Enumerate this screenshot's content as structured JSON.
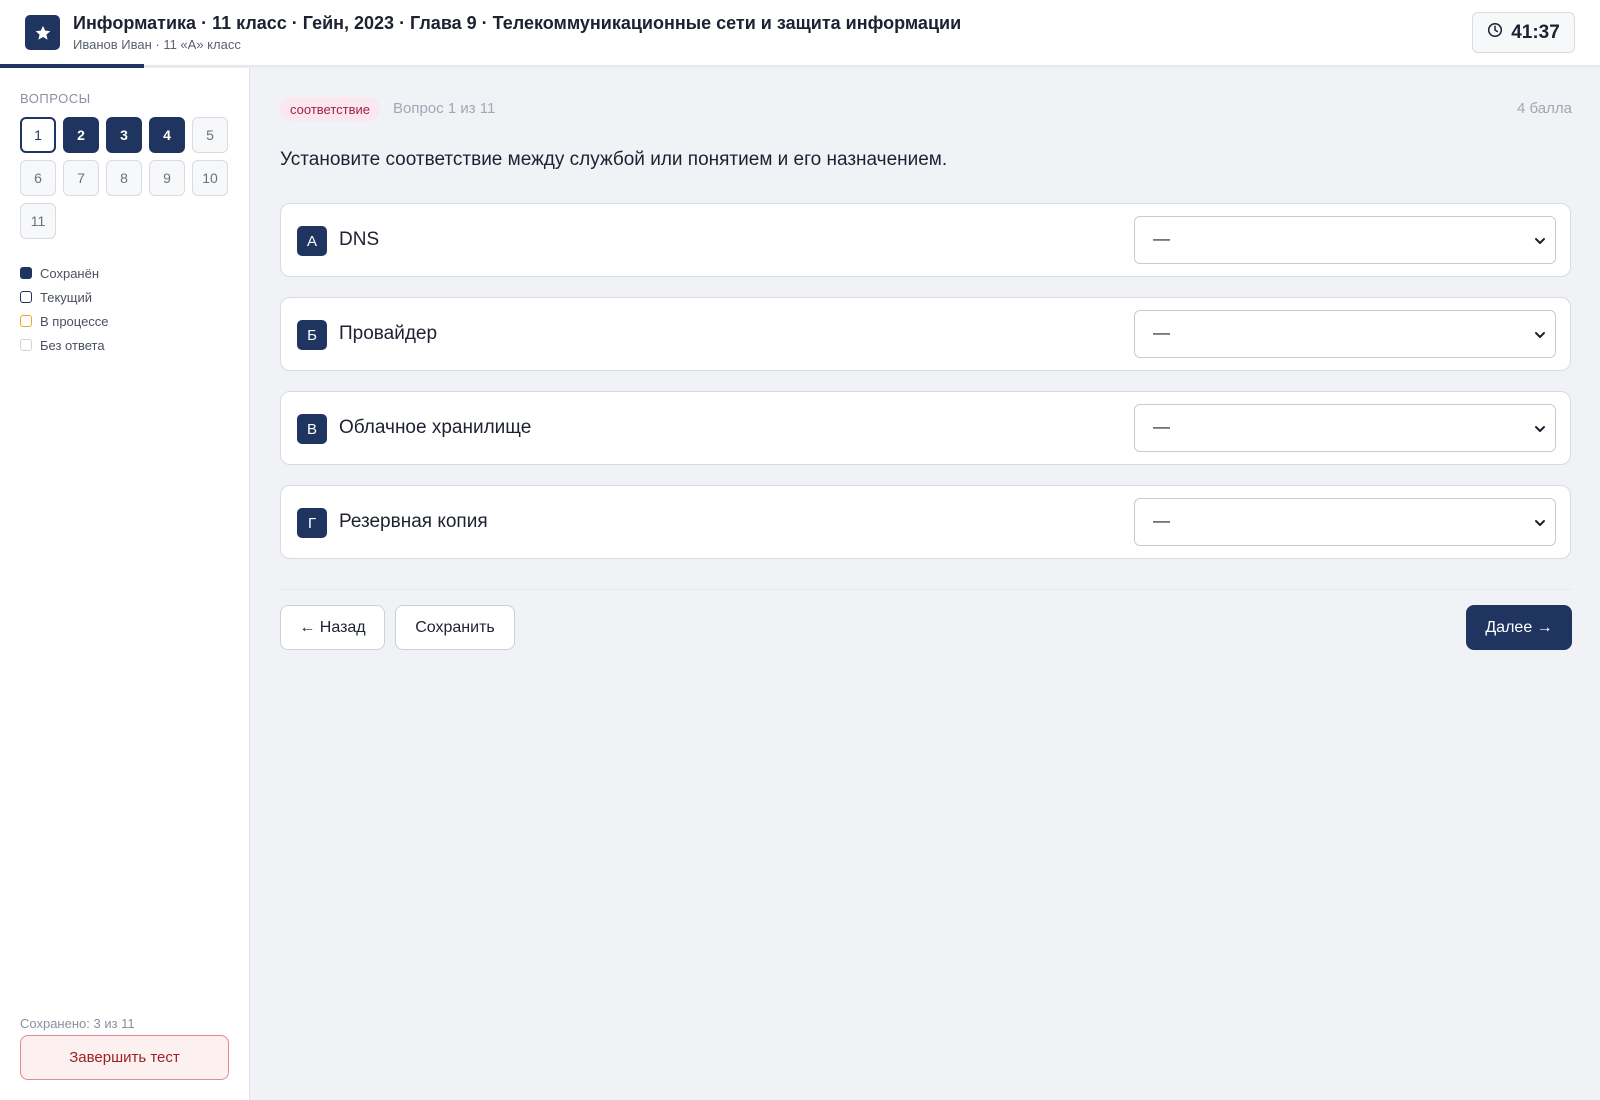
{
  "header": {
    "course_title": "Информатика · 11 класс · Гейн, 2023 · Глава 9 · Телекоммуникационные сети и защита информации",
    "student": "Иванов Иван · 11 «А» класс",
    "timer": "41:37",
    "logo_icon": "star-icon",
    "timer_icon": "clock-icon",
    "progress_fraction": 0.09
  },
  "sidebar": {
    "heading": "ВОПРОСЫ",
    "questions": [
      {
        "label": "1",
        "state": "current"
      },
      {
        "label": "2",
        "state": "saved"
      },
      {
        "label": "3",
        "state": "saved"
      },
      {
        "label": "4",
        "state": "saved"
      },
      {
        "label": "5",
        "state": "empty"
      },
      {
        "label": "6",
        "state": "empty"
      },
      {
        "label": "7",
        "state": "empty"
      },
      {
        "label": "8",
        "state": "empty"
      },
      {
        "label": "9",
        "state": "empty"
      },
      {
        "label": "10",
        "state": "empty"
      },
      {
        "label": "11",
        "state": "empty"
      }
    ],
    "legend": [
      {
        "label": "Сохранён",
        "kind": "saved"
      },
      {
        "label": "Текущий",
        "kind": "current"
      },
      {
        "label": "В процессе",
        "kind": "progress"
      },
      {
        "label": "Без ответа",
        "kind": "empty"
      }
    ],
    "saved_count": "Сохранено: 3 из 11",
    "finish_label": "Завершить тест"
  },
  "question": {
    "type_badge": "соответствие",
    "counter": "Вопрос 1 из 11",
    "points": "4 балла",
    "text": "Установите соответствие между службой или понятием и его назначением.",
    "rows": [
      {
        "letter": "А",
        "label": "DNS",
        "selected": "—"
      },
      {
        "letter": "Б",
        "label": "Провайдер",
        "selected": "—"
      },
      {
        "letter": "В",
        "label": "Облачное хранилище",
        "selected": "—"
      },
      {
        "letter": "Г",
        "label": "Резервная копия",
        "selected": "—"
      }
    ]
  },
  "nav": {
    "back_label": "← Назад",
    "save_label": "Сохранить",
    "next_label": "Далее →"
  },
  "colors": {
    "primary": "#1f3560",
    "badge_bg": "#fbe7ee",
    "badge_text": "#a2204a",
    "danger_border": "#e5898b",
    "in_progress": "#e8a830"
  }
}
